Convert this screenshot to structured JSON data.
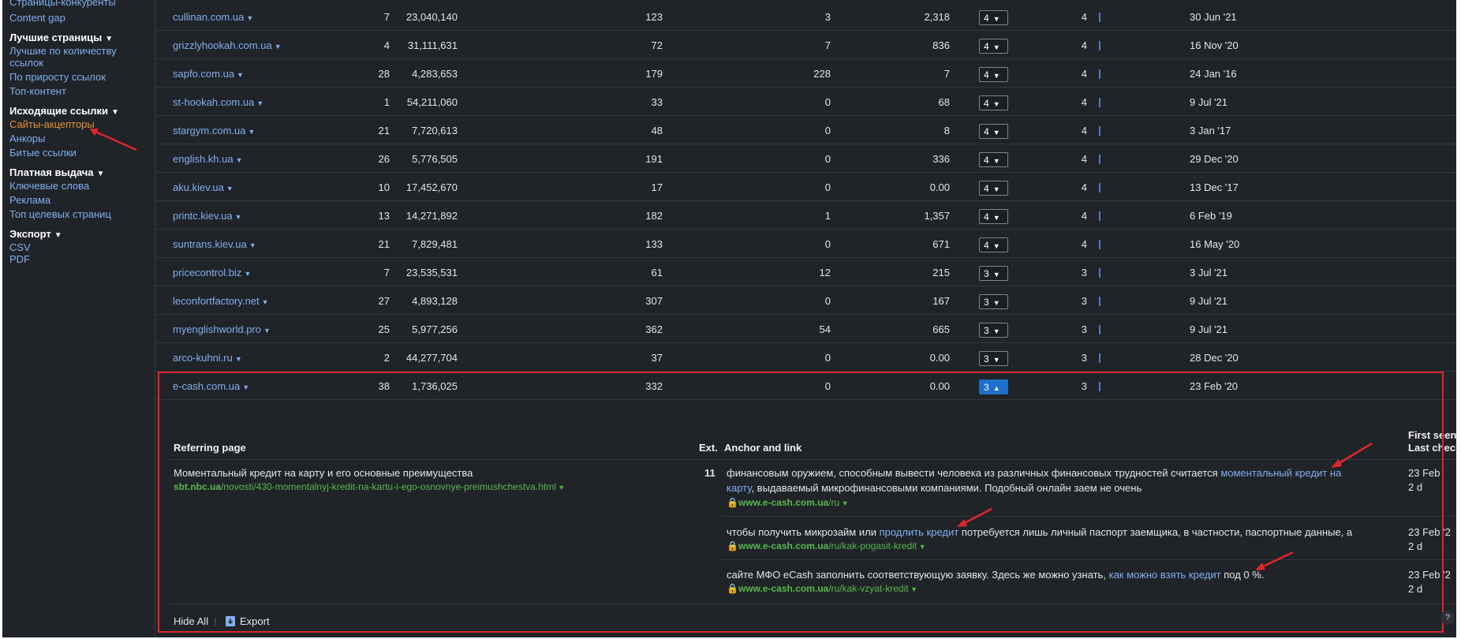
{
  "sidebar": {
    "top_items": [
      "Страницы-конкуренты",
      "Content gap"
    ],
    "best_pages": {
      "title": "Лучшие страницы",
      "items": [
        "Лучшие по количеству",
        "ссылок",
        "По приросту ссылок",
        "Топ-контент"
      ]
    },
    "outgoing": {
      "title": "Исходящие ссылки",
      "items": [
        "Сайты-акцепторы",
        "Анкоры",
        "Битые ссылки"
      ]
    },
    "paid": {
      "title": "Платная выдача",
      "items": [
        "Ключевые слова",
        "Реклама",
        "Топ целевых страниц"
      ]
    },
    "export": {
      "title": "Экспорт",
      "items": [
        "CSV",
        "PDF"
      ]
    }
  },
  "rows": [
    {
      "domain": "cullinan.com.ua",
      "c1": "7",
      "c2": "23,040,140",
      "c3": "123",
      "c4": "3",
      "c5": "2,318",
      "sel": "4",
      "c6": "4",
      "date": "30 Jun '21"
    },
    {
      "domain": "grizzlyhookah.com.ua",
      "c1": "4",
      "c2": "31,111,631",
      "c3": "72",
      "c4": "7",
      "c5": "836",
      "sel": "4",
      "c6": "4",
      "date": "16 Nov '20"
    },
    {
      "domain": "sapfo.com.ua",
      "c1": "28",
      "c2": "4,283,653",
      "c3": "179",
      "c4": "228",
      "c5": "7",
      "sel": "4",
      "c6": "4",
      "date": "24 Jan '16"
    },
    {
      "domain": "st-hookah.com.ua",
      "c1": "1",
      "c2": "54,211,060",
      "c3": "33",
      "c4": "0",
      "c5": "68",
      "sel": "4",
      "c6": "4",
      "date": "9 Jul '21"
    },
    {
      "domain": "stargym.com.ua",
      "c1": "21",
      "c2": "7,720,613",
      "c3": "48",
      "c4": "0",
      "c5": "8",
      "sel": "4",
      "c6": "4",
      "date": "3 Jan '17"
    },
    {
      "domain": "english.kh.ua",
      "c1": "26",
      "c2": "5,776,505",
      "c3": "191",
      "c4": "0",
      "c5": "336",
      "sel": "4",
      "c6": "4",
      "date": "29 Dec '20"
    },
    {
      "domain": "aku.kiev.ua",
      "c1": "10",
      "c2": "17,452,670",
      "c3": "17",
      "c4": "0",
      "c5": "0.00",
      "sel": "4",
      "c6": "4",
      "date": "13 Dec '17"
    },
    {
      "domain": "printc.kiev.ua",
      "c1": "13",
      "c2": "14,271,892",
      "c3": "182",
      "c4": "1",
      "c5": "1,357",
      "sel": "4",
      "c6": "4",
      "date": "6 Feb '19"
    },
    {
      "domain": "suntrans.kiev.ua",
      "c1": "21",
      "c2": "7,829,481",
      "c3": "133",
      "c4": "0",
      "c5": "671",
      "sel": "4",
      "c6": "4",
      "date": "16 May '20"
    },
    {
      "domain": "pricecontrol.biz",
      "c1": "7",
      "c2": "23,535,531",
      "c3": "61",
      "c4": "12",
      "c5": "215",
      "sel": "3",
      "c6": "3",
      "date": "3 Jul '21"
    },
    {
      "domain": "leconfortfactory.net",
      "c1": "27",
      "c2": "4,893,128",
      "c3": "307",
      "c4": "0",
      "c5": "167",
      "sel": "3",
      "c6": "3",
      "date": "9 Jul '21"
    },
    {
      "domain": "myenglishworld.pro",
      "c1": "25",
      "c2": "5,977,256",
      "c3": "362",
      "c4": "54",
      "c5": "665",
      "sel": "3",
      "c6": "3",
      "date": "9 Jul '21"
    },
    {
      "domain": "arco-kuhni.ru",
      "c1": "2",
      "c2": "44,277,704",
      "c3": "37",
      "c4": "0",
      "c5": "0.00",
      "sel": "3",
      "c6": "3",
      "date": "28 Dec '20"
    },
    {
      "domain": "e-cash.com.ua",
      "c1": "38",
      "c2": "1,736,025",
      "c3": "332",
      "c4": "0",
      "c5": "0.00",
      "sel": "3",
      "c6": "3",
      "date": "23 Feb '20"
    }
  ],
  "expanded": {
    "headers": {
      "referring_page": "Referring page",
      "ext": "Ext.",
      "anchor": "Anchor and link",
      "first_seen": "First seen",
      "last_check": "Last check"
    },
    "page_title": "Моментальный кредит на карту и его основные преимущества",
    "page_url_domain": "sbt.nbc.ua",
    "page_url_path": "/novosti/430-momentalnyj-kredit-na-kartu-i-ego-osnovnye-preimushchestva.html",
    "ext": "11",
    "anchors": [
      {
        "pre": "финансовым оружием, способным вывести человека из различных финансовых трудностей считается ",
        "link": "моментальный кредит на",
        "link2": "карту",
        "post": ", выдаваемый микрофинансовыми компаниями. Подобный онлайн заем не очень",
        "url_domain": "www.e-cash.com.ua",
        "url_path": "/ru",
        "first": "23 Feb",
        "ago": "2 d"
      },
      {
        "pre": "чтобы получить микрозайм или ",
        "link": "продлить кредит",
        "post": " потребуется лишь личный паспорт заемщика, в частности, паспортные данные, а",
        "url_domain": "www.e-cash.com.ua",
        "url_path": "/ru/kak-pogasit-kredit",
        "first": "23 Feb '2",
        "ago": "2 d"
      },
      {
        "pre": "сайте МФО eCash заполнить соответствующую заявку. Здесь же можно узнать, ",
        "link": "как можно взять кредит",
        "post": " под 0 %.",
        "url_domain": "www.e-cash.com.ua",
        "url_path": "/ru/kak-vzyat-kredit",
        "first": "23 Feb '2",
        "ago": "2 d"
      }
    ],
    "footer": {
      "hide_all": "Hide All",
      "export": "Export"
    }
  },
  "icons": {
    "lock": "lock-icon",
    "export": "export-icon",
    "caret": "caret-down-icon"
  },
  "colors": {
    "background": "#202328",
    "link": "#7fb0f0",
    "url": "#58b84c",
    "active": "#e8923a",
    "highlight": "#e0262b",
    "selected": "#1f6fc8"
  }
}
